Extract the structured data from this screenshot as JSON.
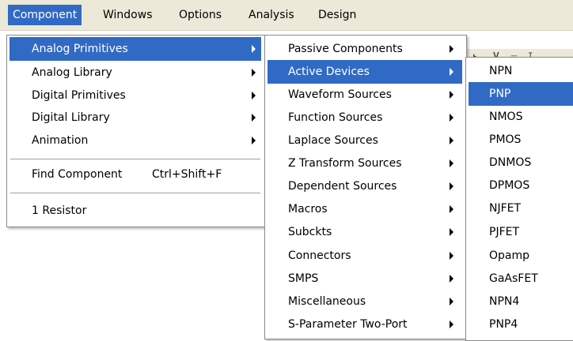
{
  "menubar": {
    "items": [
      "Component",
      "Windows",
      "Options",
      "Analysis",
      "Design"
    ]
  },
  "background_toolbar": {
    "glyphs": "⊾ ⊻ ⫧ ⊺"
  },
  "component_menu": {
    "items": [
      {
        "label": "Analog Primitives",
        "submenu": true
      },
      {
        "label": "Analog Library",
        "submenu": true
      },
      {
        "label": "Digital Primitives",
        "submenu": true
      },
      {
        "label": "Digital Library",
        "submenu": true
      },
      {
        "label": "Animation",
        "submenu": true
      },
      {
        "label": "Find Component",
        "shortcut": "Ctrl+Shift+F"
      },
      {
        "label": "1 Resistor"
      }
    ]
  },
  "analog_primitives_menu": {
    "items": [
      "Passive Components",
      "Active Devices",
      "Waveform Sources",
      "Function Sources",
      "Laplace Sources",
      "Z Transform Sources",
      "Dependent Sources",
      "Macros",
      "Subckts",
      "Connectors",
      "SMPS",
      "Miscellaneous",
      "S-Parameter Two-Port"
    ]
  },
  "active_devices_menu": {
    "items": [
      "NPN",
      "PNP",
      "NMOS",
      "PMOS",
      "DNMOS",
      "DPMOS",
      "NJFET",
      "PJFET",
      "Opamp",
      "GaAsFET",
      "NPN4",
      "PNP4"
    ]
  },
  "colors": {
    "highlight": "#316ac5",
    "menubar_bg": "#ece9d8",
    "menu_bg": "#ffffff"
  },
  "icons": {
    "submenu_arrow": "chevron-right-icon"
  }
}
